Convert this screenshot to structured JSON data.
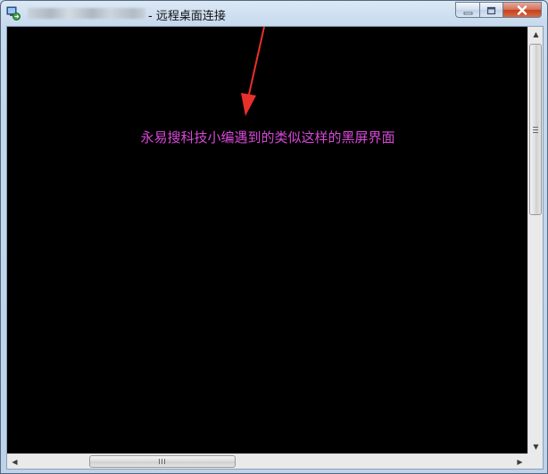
{
  "window": {
    "title": "- 远程桌面连接",
    "blurred_host_label": "192.168.1.1",
    "icons": {
      "app": "remote-desktop-icon",
      "minimize": "minimize-icon",
      "maximize": "maximize-icon",
      "close": "close-icon"
    }
  },
  "remote_session": {
    "background_color": "#000000",
    "annotation_text": "永易搜科技小编遇到的类似这样的黑屏界面",
    "annotation_color": "#d848d8",
    "arrow_color": "#e8302a"
  },
  "scrollbars": {
    "vertical_arrow_up": "▲",
    "vertical_arrow_down": "▼",
    "horizontal_arrow_left": "◀",
    "horizontal_arrow_right": "▶"
  }
}
